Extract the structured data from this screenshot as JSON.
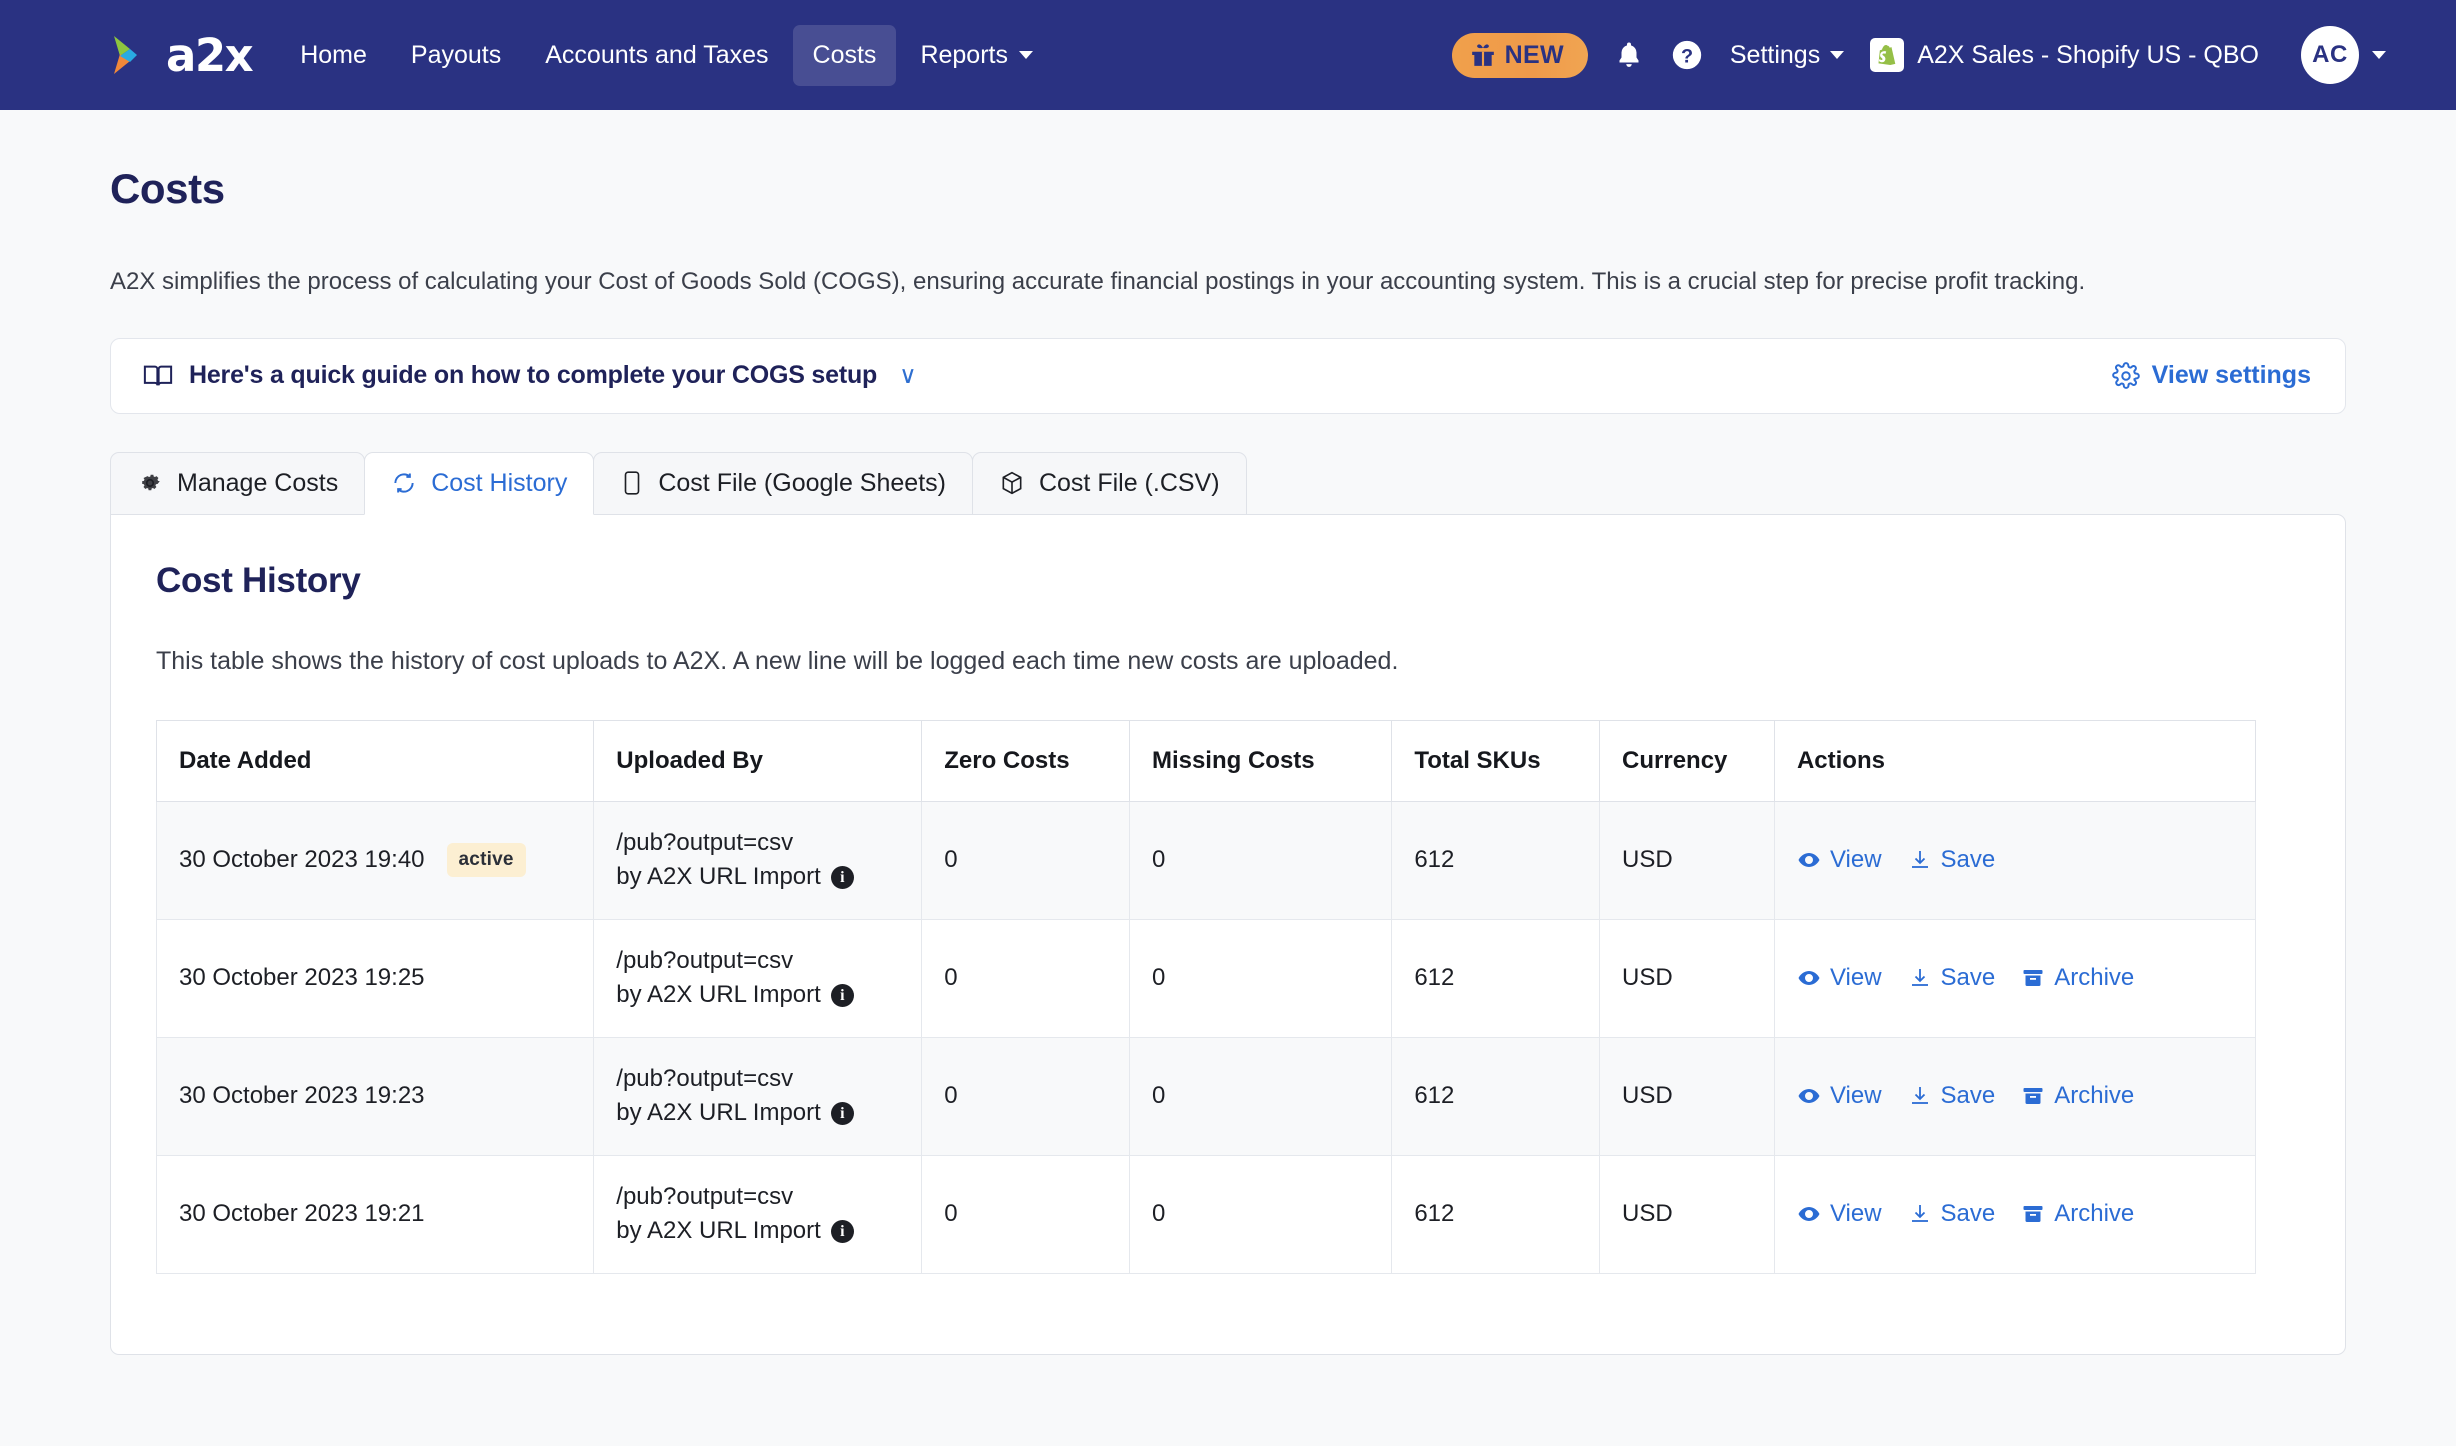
{
  "navbar": {
    "brand": "a2x",
    "links": [
      {
        "label": "Home",
        "active": false,
        "dropdown": false
      },
      {
        "label": "Payouts",
        "active": false,
        "dropdown": false
      },
      {
        "label": "Accounts and Taxes",
        "active": false,
        "dropdown": false
      },
      {
        "label": "Costs",
        "active": true,
        "dropdown": false
      },
      {
        "label": "Reports",
        "active": false,
        "dropdown": true
      }
    ],
    "new_badge": "NEW",
    "notifications_icon": "bell-icon",
    "help_icon": "question-circle-icon",
    "settings_label": "Settings",
    "account_name": "A2X Sales - Shopify US - QBO",
    "account_platform_icon": "shopify-icon",
    "avatar_initials": "AC",
    "colors": {
      "navbar_bg": "#2a3282",
      "new_badge_bg": "#f0a04b",
      "accent_link": "#2b6cd4"
    }
  },
  "page": {
    "title": "Costs",
    "description": "A2X simplifies the process of calculating your Cost of Goods Sold (COGS), ensuring accurate financial postings in your accounting system. This is a crucial step for precise profit tracking."
  },
  "guide_banner": {
    "icon": "book-icon",
    "text": "Here's a quick guide on how to complete your COGS setup",
    "chevron": "chevron-down-icon",
    "view_settings_label": "View settings",
    "view_settings_icon": "gear-icon"
  },
  "tabs": [
    {
      "label": "Manage Costs",
      "icon": "gear-icon",
      "active": false
    },
    {
      "label": "Cost History",
      "icon": "refresh-icon",
      "active": true
    },
    {
      "label": "Cost File (Google Sheets)",
      "icon": "mobile-icon",
      "active": false
    },
    {
      "label": "Cost File (.CSV)",
      "icon": "cube-icon",
      "active": false
    }
  ],
  "card": {
    "title": "Cost History",
    "description": "This table shows the history of cost uploads to A2X. A new line will be logged each time new costs are uploaded."
  },
  "table": {
    "columns": [
      "Date Added",
      "Uploaded By",
      "Zero Costs",
      "Missing Costs",
      "Total SKUs",
      "Currency",
      "Actions"
    ],
    "rows": [
      {
        "date": "30 October 2023 19:40",
        "badge": "active",
        "uploaded_by_line1": "/pub?output=csv",
        "uploaded_by_line2": "by A2X URL Import",
        "zero_costs": "0",
        "missing_costs": "0",
        "total_skus": "612",
        "currency": "USD",
        "actions": [
          {
            "label": "View",
            "icon": "eye-icon"
          },
          {
            "label": "Save",
            "icon": "download-icon"
          }
        ]
      },
      {
        "date": "30 October 2023 19:25",
        "badge": "",
        "uploaded_by_line1": "/pub?output=csv",
        "uploaded_by_line2": "by A2X URL Import",
        "zero_costs": "0",
        "missing_costs": "0",
        "total_skus": "612",
        "currency": "USD",
        "actions": [
          {
            "label": "View",
            "icon": "eye-icon"
          },
          {
            "label": "Save",
            "icon": "download-icon"
          },
          {
            "label": "Archive",
            "icon": "archive-icon"
          }
        ]
      },
      {
        "date": "30 October 2023 19:23",
        "badge": "",
        "uploaded_by_line1": "/pub?output=csv",
        "uploaded_by_line2": "by A2X URL Import",
        "zero_costs": "0",
        "missing_costs": "0",
        "total_skus": "612",
        "currency": "USD",
        "actions": [
          {
            "label": "View",
            "icon": "eye-icon"
          },
          {
            "label": "Save",
            "icon": "download-icon"
          },
          {
            "label": "Archive",
            "icon": "archive-icon"
          }
        ]
      },
      {
        "date": "30 October 2023 19:21",
        "badge": "",
        "uploaded_by_line1": "/pub?output=csv",
        "uploaded_by_line2": "by A2X URL Import",
        "zero_costs": "0",
        "missing_costs": "0",
        "total_skus": "612",
        "currency": "USD",
        "actions": [
          {
            "label": "View",
            "icon": "eye-icon"
          },
          {
            "label": "Save",
            "icon": "download-icon"
          },
          {
            "label": "Archive",
            "icon": "archive-icon"
          }
        ]
      }
    ]
  }
}
